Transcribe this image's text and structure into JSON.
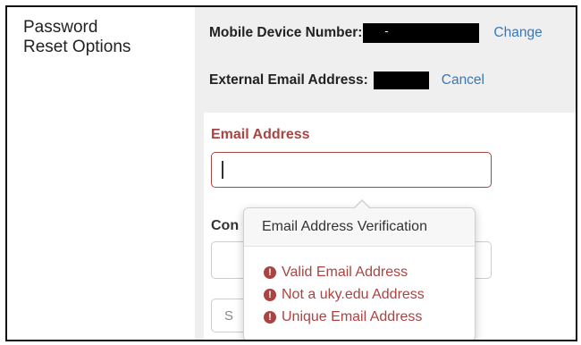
{
  "section": {
    "title_line1": "Password",
    "title_line2": "Reset Options"
  },
  "mobile": {
    "label": "Mobile Device Number:",
    "value_fragment": "-",
    "change_label": "Change"
  },
  "external_email": {
    "label": "External Email Address:",
    "cancel_label": "Cancel"
  },
  "form": {
    "email_label": "Email Address",
    "email_value": "",
    "confirm_label_visible": "Con",
    "save_label_visible": "S"
  },
  "popover": {
    "title": "Email Address Verification",
    "items": [
      "Valid Email Address",
      "Not a uky.edu Address",
      "Unique Email Address"
    ],
    "icon": "exclamation-circle-icon"
  },
  "colors": {
    "error": "#a94442",
    "link": "#3a78b5",
    "panel_bg": "#efefef"
  }
}
